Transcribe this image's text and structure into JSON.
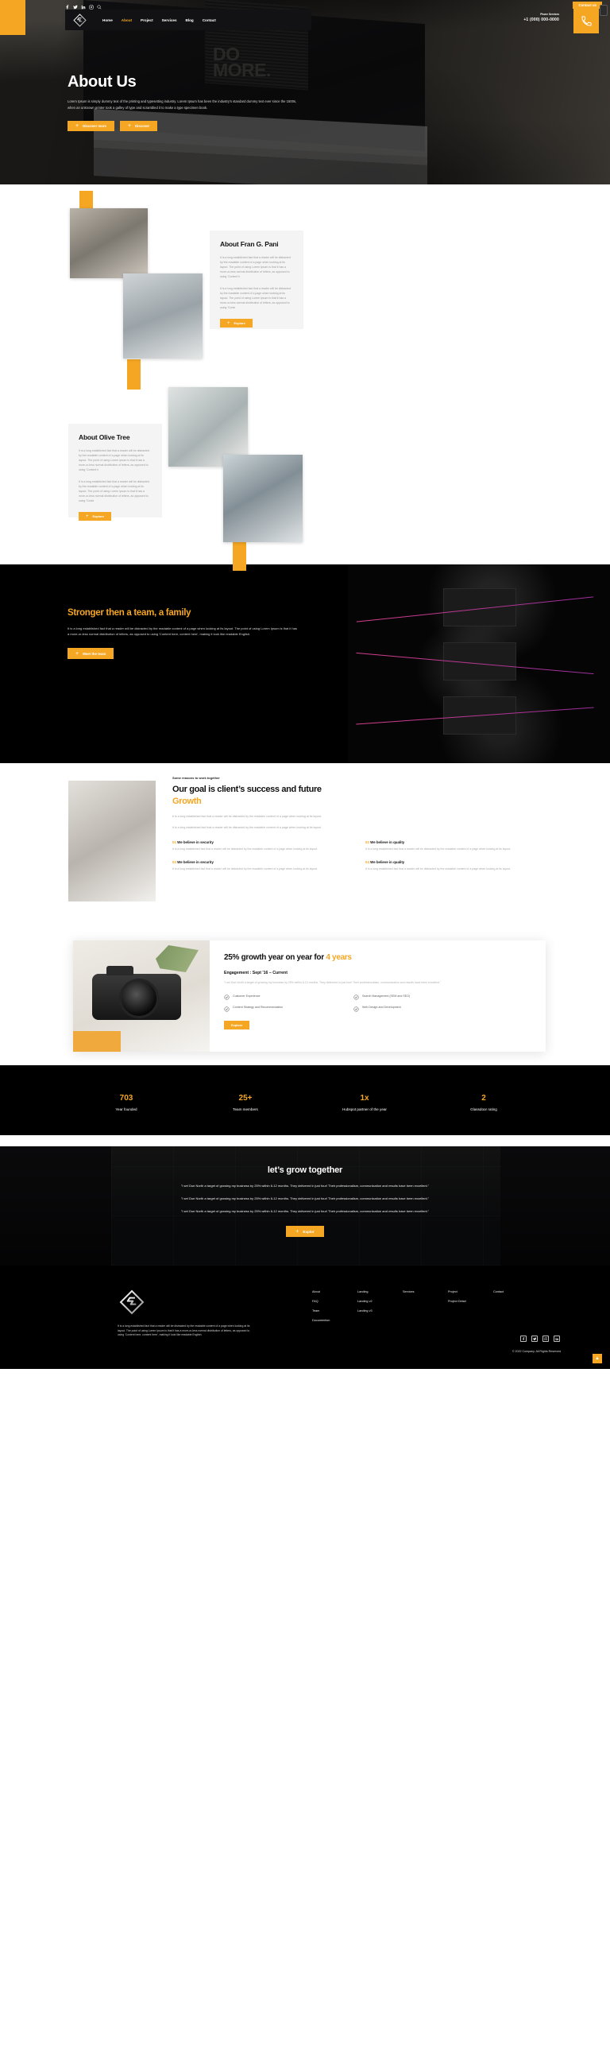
{
  "brand": {
    "accent": "#f5a623",
    "dark": "#000000"
  },
  "topbar": {
    "contact_label": "Contact us",
    "socials": [
      "facebook-icon",
      "twitter-icon",
      "linkedin-icon",
      "instagram-icon",
      "search-icon"
    ]
  },
  "nav": {
    "items": [
      {
        "label": "Home",
        "active": false
      },
      {
        "label": "About",
        "active": true
      },
      {
        "label": "Project",
        "active": false
      },
      {
        "label": "Services",
        "active": false
      },
      {
        "label": "Blog",
        "active": false
      },
      {
        "label": "Contact",
        "active": false
      }
    ],
    "phone_label": "Phone Services",
    "phone_number": "+1 (000) 000-0000"
  },
  "hero": {
    "wall_text": "DO\nMORE.",
    "title": "About Us",
    "paragraph": "Lorem Ipsum is simply dummy text of the printing and typesetting industry. Lorem Ipsum has been the industry's standard dummy text ever since the 1500s, when an unknown printer took a galley of type and scrambled it to make a type specimen book.",
    "primary_button": "Discover more",
    "secondary_button": "Discover"
  },
  "about_fran": {
    "title": "About Fran G. Pani",
    "paragraph_1": "It is a long established fact that a reader will be distracted by the readable content of a page when looking at its layout. The point of using Lorem Ipsum is that it has a more-or-less normal distribution of letters, as opposed to using 'Content h",
    "paragraph_2": "It is a long established fact that a reader will be distracted by the readable content of a page when looking at its layout. The point of using Lorem Ipsum is that it has a more-or-less normal distribution of letters, as opposed to using 'Conte",
    "button": "Explore"
  },
  "about_olive": {
    "title": "About Olive Tree",
    "paragraph_1": "It is a long established fact that a reader will be distracted by the readable content of a page when looking at its layout. The point of using Lorem Ipsum is that it has a more-or-less normal distribution of letters, as opposed to using 'Content h",
    "paragraph_2": "It is a long established fact that a reader will be distracted by the readable content of a page when looking at its layout. The point of using Lorem Ipsum is that it has a more-or-less normal distribution of letters, as opposed to using 'Conte",
    "button": "Explore"
  },
  "family": {
    "title_main": "Stronger then a team,",
    "title_accent": " a family",
    "paragraph": "It is a long established fact that a reader will be distracted by the readable content of a page when looking at its layout. The point of using Lorem Ipsum is that it has a more-or-less normal distribution of letters, as opposed to using 'Content here, content here', making it look like readable English.",
    "button": "Meet the team"
  },
  "goal": {
    "eyebrow": "Some reasons to work together",
    "title_main": "Our goal is client’s success and future",
    "title_accent": "Growth",
    "paragraph_1": "It is a long established fact that a reader will be distracted by the readable content of a page when looking at its layout.",
    "paragraph_2": "It is a long established fact that a reader will be distracted by the readable content of a page when looking at its layout.",
    "items": [
      {
        "num": "01",
        "title": "We believe in security",
        "text": "It is a long established fact that a reader will be distracted by the readable content of a page when looking at its layout."
      },
      {
        "num": "02",
        "title": "We believe in quality",
        "text": "It is a long established fact that a reader will be distracted by the readable content of a page when looking at its layout."
      },
      {
        "num": "03",
        "title": "We believe in security",
        "text": "It is a long established fact that a reader will be distracted by the readable content of a page when looking at its layout."
      },
      {
        "num": "04",
        "title": "We believe in quality",
        "text": "It is a long established fact that a reader will be distracted by the readable content of a page when looking at its layout."
      }
    ]
  },
  "growth": {
    "title_main": "25% growth year on year for ",
    "title_accent": "4 years",
    "engagement": "Engagement : Sept '16 – Current",
    "quote": "\"I set Due North a target of growing my business by 25% within 6-12 months. They delivered in just four! Their professionalism, communication and results have been excellent.\"",
    "features": [
      "Customer Experience",
      "Search Management (SEM and SEO)",
      "Content Strategy and Recommendation",
      "Web Design and Development"
    ],
    "button": "Explore"
  },
  "stats": [
    {
      "value": "703",
      "label": "Year founded"
    },
    {
      "value": "25+",
      "label": "Team members"
    },
    {
      "value": "1x",
      "label": "Hubspot partner of the year"
    },
    {
      "value": "2",
      "label": "Glassdoor rating"
    }
  ],
  "grow_together": {
    "title": "let’s grow together",
    "quotes": [
      "\"I set Due North a target of growing my business by 25% within 6-12 months. They delivered in just four! Their professionalism, communication and results have been excellent.\"",
      "\"I set Due North a target of growing my business by 25% within 6-12 months. They delivered in just four! Their professionalism, communication and results have been excellent.\"",
      "\"I set Due North a target of growing my business by 25% within 6-12 months. They delivered in just four! Their professionalism, communication and results have been excellent.\""
    ],
    "button": "Explor"
  },
  "footer": {
    "about_text": "It is a long established fact that a reader will be distracted by the readable content of a page when looking at its layout. The point of using Lorem Ipsum is that it has a more-or-less normal distribution of letters, as opposed to using 'Content here, content here', making it look like readable English.",
    "columns": [
      [
        "About",
        "FAQ",
        "Team",
        "Documention"
      ],
      [
        "Landing",
        "Landing v2",
        "Landing v3"
      ],
      [
        "Services"
      ],
      [
        "Project",
        "Project Detail"
      ],
      [
        "Contact"
      ]
    ],
    "socials": [
      "facebook-icon",
      "twitter-icon",
      "instagram-icon",
      "linkedin-icon"
    ],
    "copyright": "© 2022 Company. All Rights Reserved",
    "back_to_top": "▲"
  }
}
